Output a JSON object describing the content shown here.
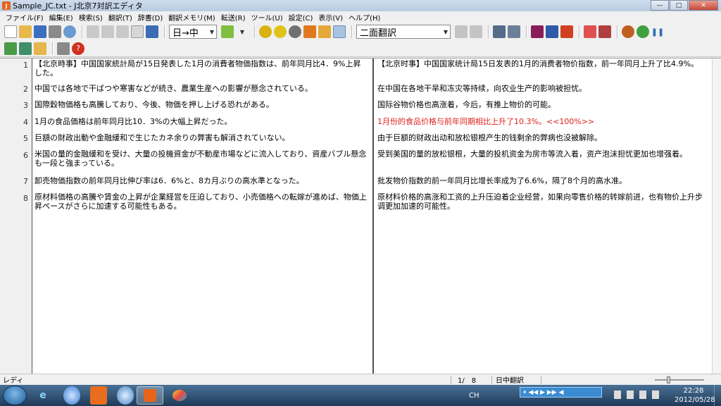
{
  "window": {
    "title": "Sample_JC.txt - J北京7対訳エディタ",
    "app_icon_glyph": "J"
  },
  "window_controls": {
    "minimize": "—",
    "maximize": "□",
    "close": "✕"
  },
  "menu": [
    "ファイル(F)",
    "編集(E)",
    "検索(S)",
    "翻訳(T)",
    "辞書(D)",
    "翻訳メモリ(M)",
    "転送(R)",
    "ツール(U)",
    "設定(C)",
    "表示(V)",
    "ヘルプ(H)"
  ],
  "toolbar": {
    "direction_select": "日→中",
    "view_mode_select": "二面翻訳"
  },
  "lines": [
    {
      "num": "1",
      "jp": "【北京時事】中国国家統計局が15日発表した1月の消費者物価指数は、前年同月比4．9%上昇した。",
      "cn": "【北京时事】中国国家统计局15日发表的1月的消费者物价指数，前一年同月上升了比4.9%。"
    },
    {
      "num": "2",
      "jp": "中国では各地で干ばつや寒害などが続き、農業生産への影響が懸念されている。",
      "cn": "在中国在各地干旱和冻灾等持续，向农业生产的影响被担忧。"
    },
    {
      "num": "3",
      "jp": "国際穀物価格も高騰しており、今後、物価を押し上げる恐れがある。",
      "cn": "国际谷物价格也高涨着，今后，有推上物价的可能。"
    },
    {
      "num": "4",
      "jp": "1月の食品価格は前年同月比10．3%の大幅上昇だった。",
      "cn": "1月份的食品价格与前年同期相比上升了10.3%。<<100%>>"
    },
    {
      "num": "5",
      "jp": "巨額の財政出動や金融緩和で生じたカネ余りの弊害も解消されていない。",
      "cn": "由于巨额的财政出动和放松银根产生的钱剩余的弊病也没被解除。"
    },
    {
      "num": "6",
      "jp": "米国の量的金融緩和を受け、大量の投機資金が不動産市場などに流入しており、資産バブル懸念も一段と強まっている。",
      "cn": "受到美国的量的放松银根，大量的投机资金为房市等流入着，资产泡沫担忧更加也增强着。"
    },
    {
      "num": "7",
      "jp": "卸売物価指数の前年同月比伸び率は6．6%と、8カ月ぶりの高水準となった。",
      "cn": "批发物价指数的前一年同月比增长率成为了6.6%，隔了8个月的高水准。"
    },
    {
      "num": "8",
      "jp": "原材料価格の高騰や賃金の上昇が企業経営を圧迫しており、小売価格への転嫁が進めば、物価上昇ペースがさらに加速する可能性もある。",
      "cn": "原材料价格的高涨和工资的上升压迫着企业经营，如果向零售价格的转嫁前进，也有物价上升步调更加加速的可能性。"
    }
  ],
  "highlight_color": "#e0201a",
  "status": {
    "text": "レディ",
    "page": "1/　8",
    "mode": "日中翻訳"
  },
  "taskbar": {
    "tray_lang": "CH",
    "media_label": "⏸ ◀◀ ▶ ▶▶ ◀",
    "time": "22:28",
    "date": "2012/05/28"
  }
}
